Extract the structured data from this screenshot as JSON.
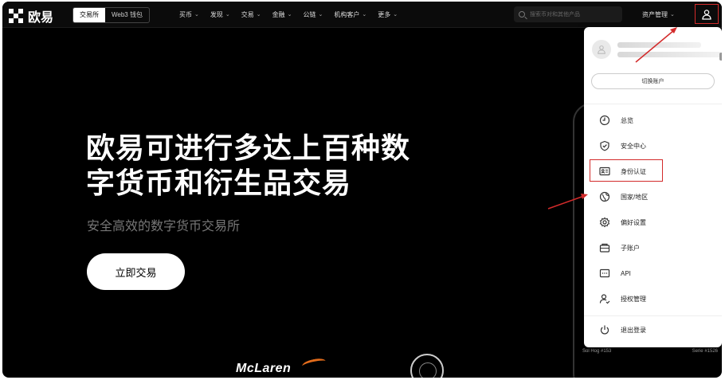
{
  "header": {
    "logo_text": "欧易",
    "tabs": [
      {
        "label": "交易所",
        "active": true
      },
      {
        "label": "Web3 钱包",
        "active": false
      }
    ],
    "menu": [
      "买币",
      "发现",
      "交易",
      "金融",
      "公链",
      "机构客户",
      "更多"
    ],
    "search_placeholder": "搜索币对和其他产品",
    "asset_label": "资产管理"
  },
  "hero": {
    "title_line1": "欧易可进行多达上百种数",
    "title_line2": "字货币和衍生品交易",
    "subtitle": "安全高效的数字货币交易所",
    "cta": "立即交易"
  },
  "dropdown": {
    "switch_account": "切换账户",
    "items": [
      {
        "label": "总览",
        "icon": "clock-icon"
      },
      {
        "label": "安全中心",
        "icon": "shield-icon"
      },
      {
        "label": "身份认证",
        "icon": "id-card-icon",
        "highlighted": true
      },
      {
        "label": "国家/地区",
        "icon": "globe-icon"
      },
      {
        "label": "偏好设置",
        "icon": "gear-icon"
      },
      {
        "label": "子账户",
        "icon": "sub-account-icon"
      },
      {
        "label": "API",
        "icon": "api-icon"
      },
      {
        "label": "授权管理",
        "icon": "authorization-icon"
      },
      {
        "label": "退出登录",
        "icon": "power-icon"
      }
    ]
  },
  "background": {
    "nft_left": "Sol Hog #153",
    "nft_right": "Serie #1526",
    "partner": "McLaren"
  },
  "colors": {
    "accent_red": "#d32b2b",
    "background": "#000000",
    "text_white": "#ffffff"
  }
}
